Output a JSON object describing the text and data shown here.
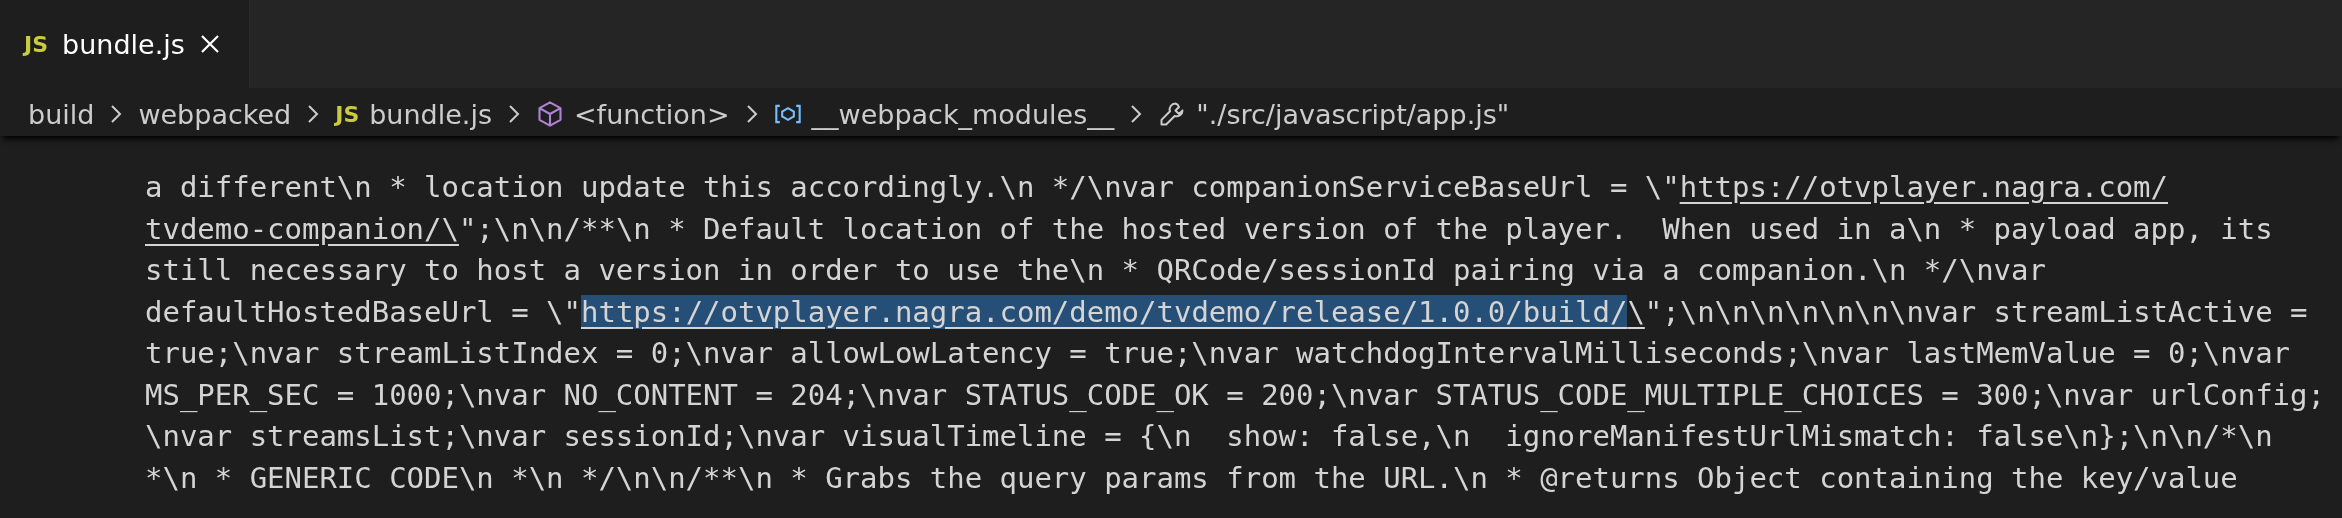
{
  "tabs": [
    {
      "icon_text": "JS",
      "label": "bundle.js",
      "selected": true
    }
  ],
  "breadcrumbs": [
    {
      "kind": "folder",
      "label": "build"
    },
    {
      "kind": "folder",
      "label": "webpacked"
    },
    {
      "kind": "file",
      "icon_text": "JS",
      "label": "bundle.js"
    },
    {
      "kind": "function",
      "label": "<function>"
    },
    {
      "kind": "module",
      "label": "__webpack_modules__"
    },
    {
      "kind": "string",
      "label": "\"./src/javascript/app.js\""
    }
  ],
  "code_lines": [
    [
      {
        "kind": "plain",
        "text": "a different\\n * location update this accordingly.\\n */\\nvar companionServiceBaseUrl = \\\""
      },
      {
        "kind": "link",
        "text": "https://otvplayer.nagra.com/",
        "selected": false
      }
    ],
    [
      {
        "kind": "link",
        "text": "tvdemo-companion/\\",
        "selected": false
      },
      {
        "kind": "plain",
        "text": "\";\\n\\n/**\\n * Default location of the hosted version of the player.  When used in a\\n * payload app, its"
      }
    ],
    [
      {
        "kind": "plain",
        "text": "still necessary to host a version in order to use the\\n * QRCode/sessionId pairing via a companion.\\n */\\nvar"
      }
    ],
    [
      {
        "kind": "plain",
        "text": "defaultHostedBaseUrl = \\\""
      },
      {
        "kind": "link",
        "text": "https://otvplayer.nagra.com/demo/tvdemo/release/1.0.0/build/",
        "selected": true
      },
      {
        "kind": "link",
        "text": "\\",
        "selected": false
      },
      {
        "kind": "plain",
        "text": "\";\\n\\n\\n\\n\\n\\n\\nvar streamListActive ="
      }
    ],
    [
      {
        "kind": "plain",
        "text": "true;\\nvar streamListIndex = 0;\\nvar allowLowLatency = true;\\nvar watchdogIntervalMilliseconds;\\nvar lastMemValue = 0;\\nvar"
      }
    ],
    [
      {
        "kind": "plain",
        "text": "MS_PER_SEC = 1000;\\nvar NO_CONTENT = 204;\\nvar STATUS_CODE_OK = 200;\\nvar STATUS_CODE_MULTIPLE_CHOICES = 300;\\nvar urlConfig;"
      }
    ],
    [
      {
        "kind": "plain",
        "text": "\\nvar streamsList;\\nvar sessionId;\\nvar visualTimeline = {\\n  show: false,\\n  ignoreManifestUrlMismatch: false\\n};\\n\\n/*\\n"
      }
    ],
    [
      {
        "kind": "plain",
        "text": "*\\n * GENERIC CODE\\n *\\n */\\n\\n/**\\n * Grabs the query params from the URL.\\n * @returns Object containing the key/value"
      }
    ]
  ]
}
